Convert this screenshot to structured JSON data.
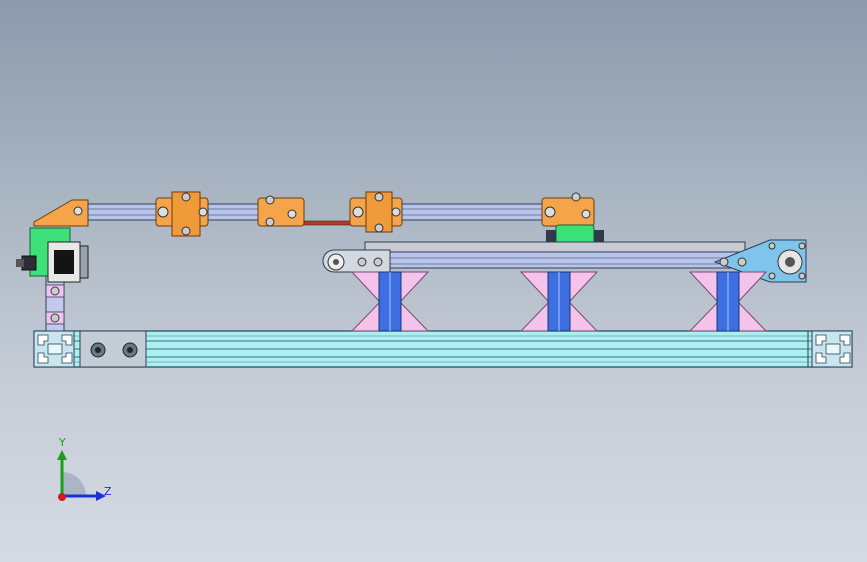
{
  "viewport": {
    "background_top": "#8d9aac",
    "background_bottom": "#d6dbe3"
  },
  "model": {
    "colors": {
      "profile_fill": "#aaf0f0",
      "profile_stroke": "#2b3f55",
      "rail_fill": "#b8c4ea",
      "bracket_orange": "#f5a44a",
      "support_pink": "#f3c3ec",
      "support_blue": "#3d6fe0",
      "carriage_green": "#3ee07a",
      "plate_blue": "#7fc4ea",
      "belt_red": "#b03a2e"
    }
  },
  "triad": {
    "y_label": "Y",
    "z_label": "Z",
    "y_color": "#1c9e1c",
    "z_color": "#1d2fd6",
    "x_color": "#d01c1c"
  }
}
